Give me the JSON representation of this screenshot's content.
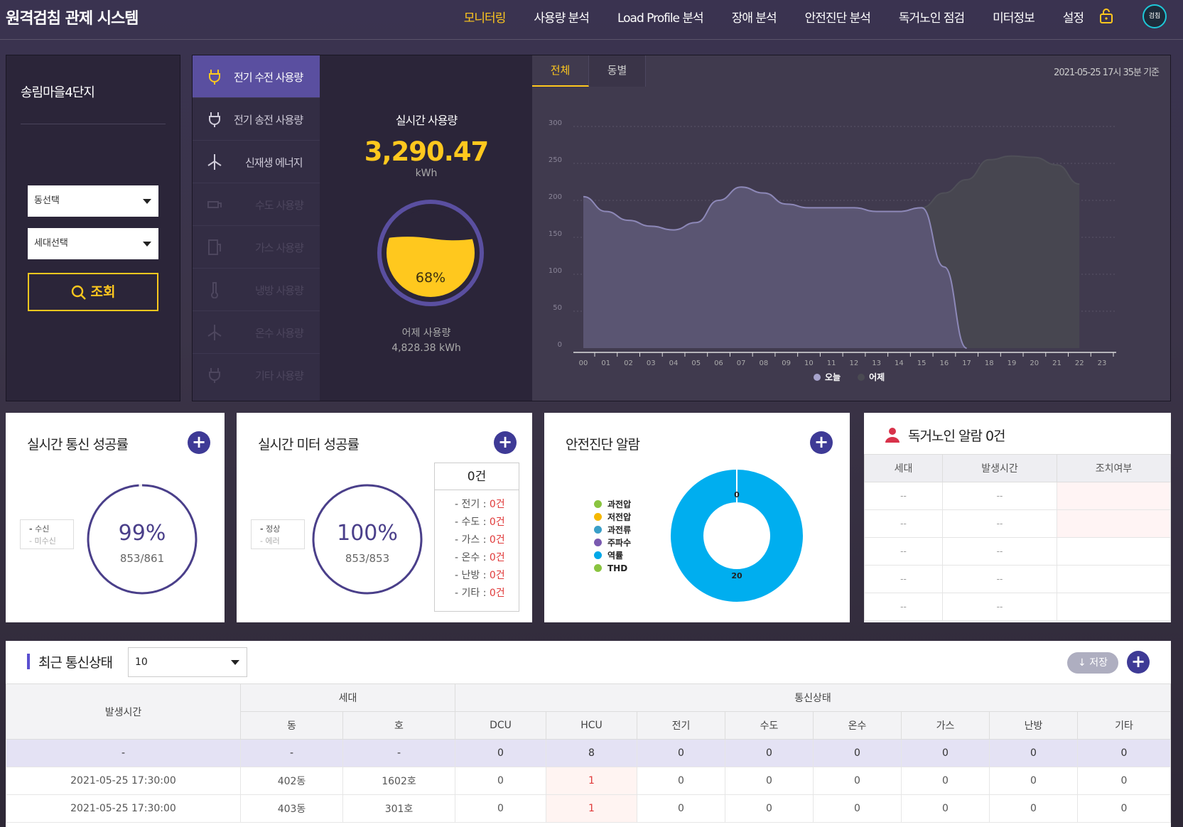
{
  "header": {
    "title": "원격검침 관제 시스템",
    "nav": [
      "모니터링",
      "사용량 분석",
      "Load Profile 분석",
      "장애 분석",
      "안전진단 분석",
      "독거노인 점검",
      "미터정보",
      "설정"
    ],
    "user_badge": "검침"
  },
  "left": {
    "complex": "송림마을4단지",
    "dong_select": "동선택",
    "unit_select": "세대선택",
    "search_label": "조회"
  },
  "menu": {
    "items": [
      "전기 수전 사용량",
      "전기 송전 사용량",
      "신재생 에너지",
      "수도 사용량",
      "가스 사용량",
      "냉방 사용량",
      "온수 사용량",
      "기타 사용량"
    ]
  },
  "realtime": {
    "title": "실시간 사용량",
    "value": "3,290.47",
    "unit": "kWh",
    "gauge_pct_label": "68%",
    "gauge_pct": 68,
    "yesterday_label": "어제 사용량",
    "yesterday_value": "4,828.38 kWh"
  },
  "chart_tabs": [
    "전체",
    "동별"
  ],
  "chart_stamp": "2021-05-25 17시 35분 기준",
  "chart_data": {
    "type": "area",
    "categories": [
      "00",
      "01",
      "02",
      "03",
      "04",
      "05",
      "06",
      "07",
      "08",
      "09",
      "10",
      "11",
      "12",
      "13",
      "14",
      "15",
      "16",
      "17",
      "18",
      "19",
      "20",
      "21",
      "22",
      "23"
    ],
    "ylim": [
      0,
      300
    ],
    "yticks": [
      0,
      50,
      100,
      150,
      200,
      250,
      300
    ],
    "series": [
      {
        "name": "오늘",
        "color": "#7b76a8",
        "values": [
          205,
          185,
          173,
          165,
          160,
          170,
          200,
          218,
          210,
          195,
          190,
          190,
          190,
          185,
          185,
          190,
          110,
          0,
          null,
          null,
          null,
          null,
          null,
          null
        ]
      },
      {
        "name": "어제",
        "color": "#4a4a52",
        "values": [
          200,
          183,
          172,
          163,
          160,
          168,
          198,
          217,
          208,
          193,
          188,
          188,
          187,
          183,
          183,
          190,
          210,
          228,
          255,
          260,
          258,
          248,
          222,
          null
        ]
      }
    ]
  },
  "comm_rate": {
    "title": "실시간 통신 성공률",
    "legend": [
      "수신",
      "미수신"
    ],
    "pct_label": "99%",
    "pct": 99,
    "count": "853/861"
  },
  "meter_rate": {
    "title": "실시간 미터 성공률",
    "legend": [
      "정상",
      "에러"
    ],
    "pct_label": "100%",
    "pct": 100,
    "count": "853/853",
    "error_total": "0건",
    "errors": [
      {
        "label": "- 전기 : ",
        "value": "0건"
      },
      {
        "label": "- 수도 : ",
        "value": "0건"
      },
      {
        "label": "- 가스 : ",
        "value": "0건"
      },
      {
        "label": "- 온수 : ",
        "value": "0건"
      },
      {
        "label": "- 난방 : ",
        "value": "0건"
      },
      {
        "label": "- 기타 : ",
        "value": "0건"
      }
    ]
  },
  "safety": {
    "title": "안전진단 알람",
    "legend": [
      {
        "name": "과전압",
        "color": "#8ac440"
      },
      {
        "name": "저전압",
        "color": "#f5b800"
      },
      {
        "name": "과전류",
        "color": "#3a9fc8"
      },
      {
        "name": "주파수",
        "color": "#7a5ab0"
      },
      {
        "name": "역률",
        "color": "#00a8e8"
      },
      {
        "name": "THD",
        "color": "#8ac440"
      }
    ],
    "donut_labels": [
      "0",
      "20"
    ],
    "donut_values": [
      0,
      20
    ]
  },
  "elder": {
    "title": "독거노인 알람 0건",
    "columns": [
      "세대",
      "발생시간",
      "조치여부"
    ],
    "rows": [
      [
        "--",
        "--",
        ""
      ],
      [
        "--",
        "--",
        ""
      ],
      [
        "--",
        "--",
        ""
      ],
      [
        "--",
        "--",
        ""
      ],
      [
        "--",
        "--",
        ""
      ]
    ]
  },
  "comm_status": {
    "title": "최근 통신상태",
    "page_size": "10",
    "save_label": "저장",
    "group_headers": [
      "발생시간",
      "세대",
      "통신상태"
    ],
    "sub_headers": [
      "동",
      "호",
      "DCU",
      "HCU",
      "전기",
      "수도",
      "온수",
      "가스",
      "난방",
      "기타"
    ],
    "rows": [
      [
        "-",
        "-",
        "-",
        "0",
        "8",
        "0",
        "0",
        "0",
        "0",
        "0",
        "0"
      ],
      [
        "2021-05-25 17:30:00",
        "402동",
        "1602호",
        "0",
        "1",
        "0",
        "0",
        "0",
        "0",
        "0",
        "0"
      ],
      [
        "2021-05-25 17:30:00",
        "403동",
        "301호",
        "0",
        "1",
        "0",
        "0",
        "0",
        "0",
        "0",
        "0"
      ]
    ]
  }
}
